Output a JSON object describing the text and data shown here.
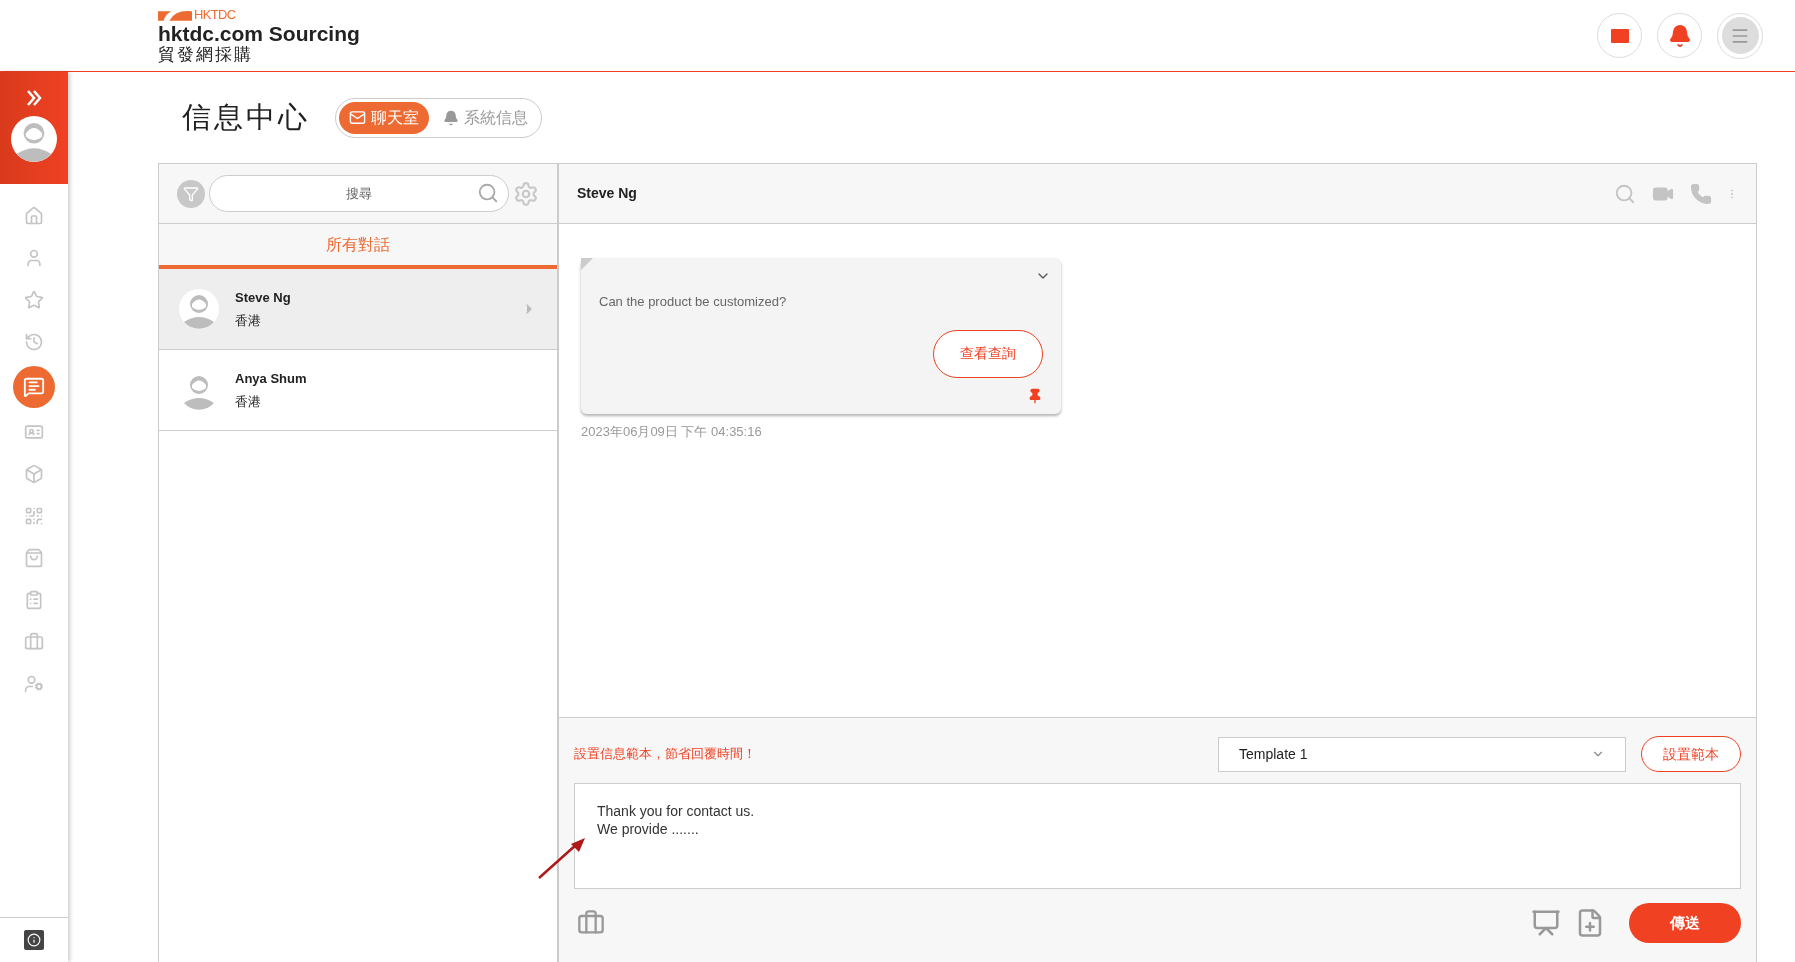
{
  "header": {
    "logo_mark": "HKTDC",
    "brand": "hktdc.com Sourcing",
    "brand_sub": "貿發網採購"
  },
  "sidebar": {
    "items": [
      {
        "kind": "home",
        "selected": false
      },
      {
        "kind": "profile",
        "selected": false
      },
      {
        "kind": "favourites",
        "selected": false
      },
      {
        "kind": "history",
        "selected": false
      },
      {
        "kind": "messages",
        "selected": true
      },
      {
        "kind": "card",
        "selected": false
      },
      {
        "kind": "products",
        "selected": false
      },
      {
        "kind": "qr",
        "selected": false
      },
      {
        "kind": "bag",
        "selected": false
      },
      {
        "kind": "checklist",
        "selected": false
      },
      {
        "kind": "briefcase",
        "selected": false
      },
      {
        "kind": "settings",
        "selected": false
      }
    ]
  },
  "page_title": "信息中心",
  "tabs": [
    {
      "label": "聊天室",
      "kind": "chat",
      "selected": true
    },
    {
      "label": "系統信息",
      "kind": "system",
      "selected": false
    }
  ],
  "conversation_list": {
    "search": {
      "placeholder": "搜尋"
    },
    "filter_tab": "所有對話",
    "conversations": [
      {
        "name": "Steve Ng",
        "location": "香港",
        "selected": true
      },
      {
        "name": "Anya Shum",
        "location": "香港",
        "selected": false
      }
    ]
  },
  "chat": {
    "contact_name": "Steve Ng",
    "messages": [
      {
        "text": "Can the product be customized?",
        "button": "查看查詢",
        "timestamp": "2023年06月09日 下午 04:35:16"
      }
    ]
  },
  "compose": {
    "hint": "設置信息範本，節省回覆時間！",
    "template": "Template 1",
    "template_button": "設置範本",
    "lines": [
      "Thank you for contact us.",
      "We provide ......."
    ],
    "send": "傳送"
  }
}
